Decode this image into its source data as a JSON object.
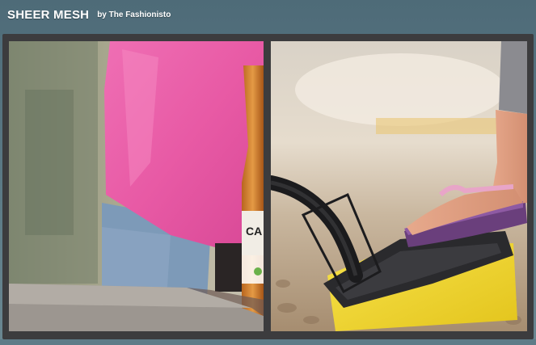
{
  "header": {
    "title": "SHEER MESH",
    "byline": "by The Fashionisto"
  },
  "panels": [
    {
      "name": "left-image",
      "subject": "pink-shirt-and-bottle"
    },
    {
      "name": "right-image",
      "subject": "flip-flop-on-air-pump"
    }
  ],
  "colors": {
    "background": "#56737f",
    "frame": "#3c3c3e",
    "pink": "#e85fa8",
    "yellow": "#f2d92e"
  }
}
